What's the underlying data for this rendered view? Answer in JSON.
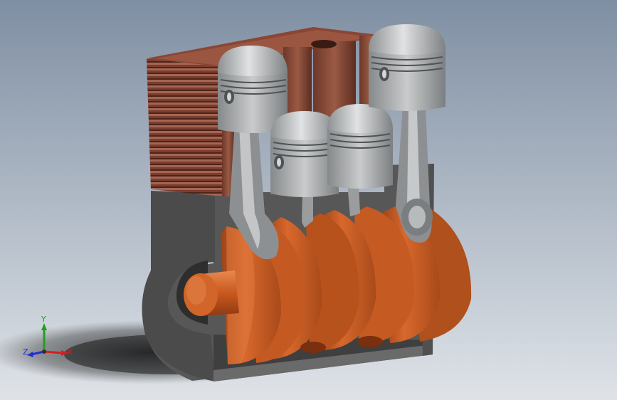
{
  "viewport": {
    "background_top": "#7f8fa3",
    "background_bottom": "#dfe3e8"
  },
  "colors": {
    "crank_orange": "#c8581e",
    "crank_orange_dark": "#8f3a12",
    "crank_orange_light": "#e0743a",
    "block_dark": "#4a4a4a",
    "block_mid": "#5e5e5e",
    "liner_brown": "#8a4a36",
    "liner_brown_dark": "#5e2f22",
    "piston_gray": "#b9bbbd",
    "piston_light": "#dcdedf",
    "piston_dark": "#8d9092",
    "rod_gray": "#9a9c9e"
  },
  "triad": {
    "x_label": "X",
    "y_label": "Y",
    "z_label": "Z",
    "x_color": "#d42020",
    "y_color": "#20a020",
    "z_color": "#2030d0"
  }
}
